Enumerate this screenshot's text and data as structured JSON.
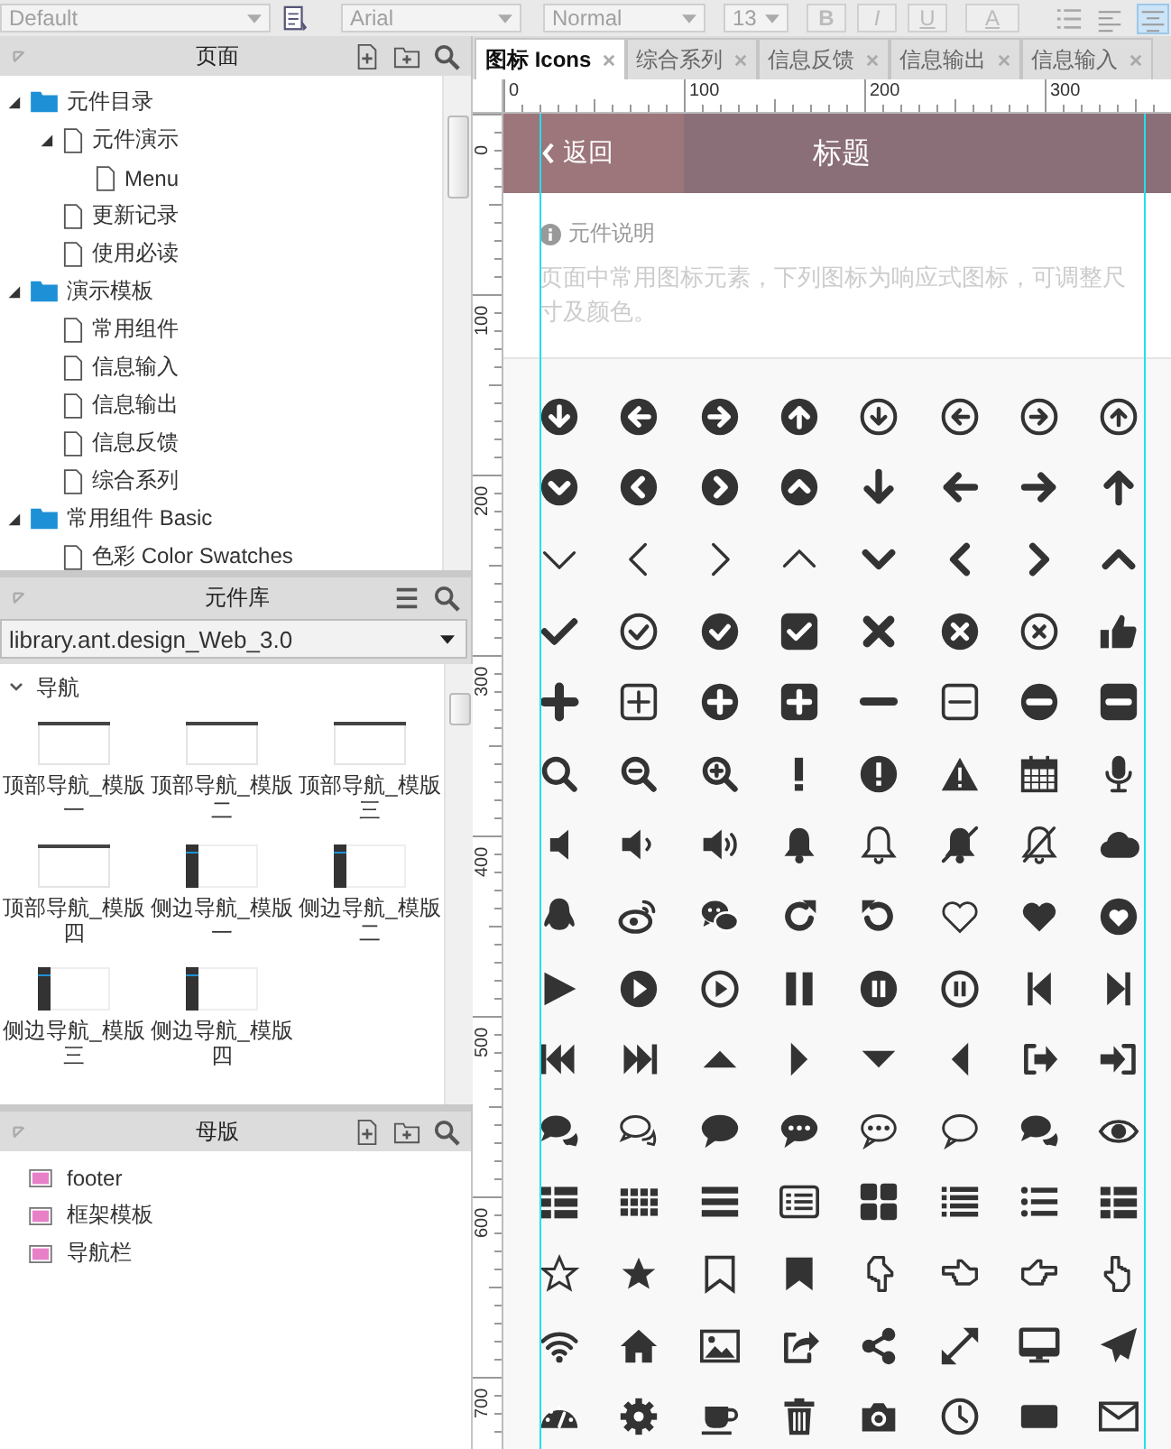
{
  "toolbar": {
    "style": "Default",
    "font": "Arial",
    "weight": "Normal",
    "size": "13",
    "format_buttons": [
      "B",
      "I",
      "U"
    ],
    "color_button": "A",
    "align_buttons": [
      {
        "selected": false
      },
      {
        "selected": true
      }
    ]
  },
  "pages": {
    "title": "页面",
    "tree": [
      {
        "label": "元件目录",
        "kind": "folder",
        "expanded": true,
        "children": [
          {
            "label": "元件演示",
            "kind": "page",
            "expanded": true,
            "children": [
              {
                "label": "Menu",
                "kind": "page"
              }
            ]
          },
          {
            "label": "更新记录",
            "kind": "page"
          },
          {
            "label": "使用必读",
            "kind": "page"
          }
        ]
      },
      {
        "label": "演示模板",
        "kind": "folder",
        "expanded": true,
        "children": [
          {
            "label": "常用组件",
            "kind": "page"
          },
          {
            "label": "信息输入",
            "kind": "page"
          },
          {
            "label": "信息输出",
            "kind": "page"
          },
          {
            "label": "信息反馈",
            "kind": "page"
          },
          {
            "label": "综合系列",
            "kind": "page"
          }
        ]
      },
      {
        "label": "常用组件 Basic",
        "kind": "folder",
        "expanded": true,
        "children": [
          {
            "label": "色彩 Color Swatches",
            "kind": "page"
          }
        ]
      }
    ]
  },
  "library": {
    "title": "元件库",
    "source": "library.ant.design_Web_3.0",
    "groups": [
      {
        "label": "导航",
        "expanded": true,
        "items": [
          {
            "label": "顶部导航_模版一",
            "kind": "top"
          },
          {
            "label": "顶部导航_模版二",
            "kind": "top"
          },
          {
            "label": "顶部导航_模版三",
            "kind": "top"
          },
          {
            "label": "顶部导航_模版四",
            "kind": "top"
          },
          {
            "label": "侧边导航_模版一",
            "kind": "side"
          },
          {
            "label": "侧边导航_模版二",
            "kind": "side"
          },
          {
            "label": "侧边导航_模版三",
            "kind": "side"
          },
          {
            "label": "侧边导航_模版四",
            "kind": "side"
          }
        ]
      }
    ]
  },
  "masters": {
    "title": "母版",
    "items": [
      "footer",
      "框架模板",
      "导航栏"
    ]
  },
  "tabs": [
    {
      "label": "图标 Icons",
      "selected": true
    },
    {
      "label": "综合系列",
      "selected": false
    },
    {
      "label": "信息反馈",
      "selected": false
    },
    {
      "label": "信息输出",
      "selected": false
    },
    {
      "label": "信息输入",
      "selected": false
    }
  ],
  "rulers": {
    "horizontal_labels": [
      "0",
      "100",
      "200",
      "300"
    ],
    "vertical_labels": [
      "0",
      "100",
      "200",
      "300",
      "400",
      "500",
      "600",
      "700"
    ]
  },
  "canvas": {
    "back": "返回",
    "title": "标题",
    "info_heading": "元件说明",
    "description": "页面中常用图标元素，下列图标为响应式图标，可调整尺寸及颜色。"
  }
}
